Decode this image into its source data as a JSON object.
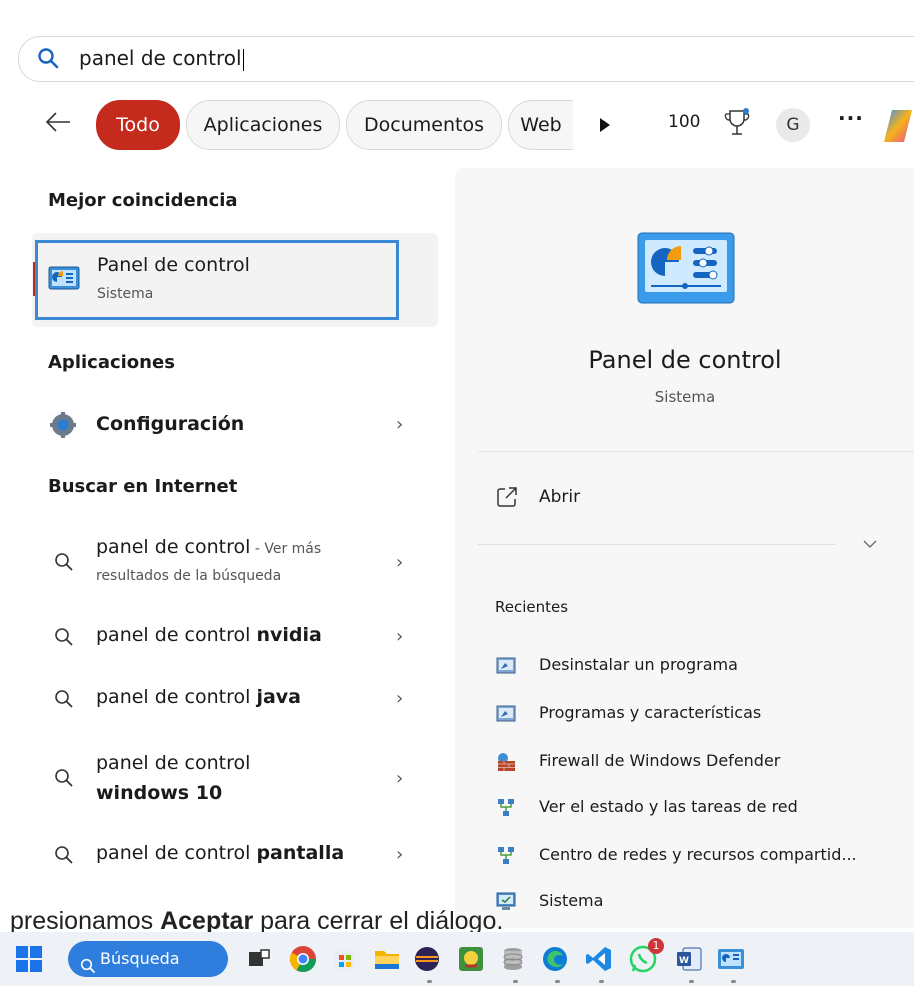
{
  "search": {
    "query": "panel de control"
  },
  "filters": {
    "tabs": [
      {
        "label": "Todo",
        "active": true
      },
      {
        "label": "Aplicaciones",
        "active": false
      },
      {
        "label": "Documentos",
        "active": false
      },
      {
        "label": "Web",
        "active": false
      }
    ],
    "points": "100",
    "avatar_initial": "G",
    "more": "···"
  },
  "best_match": {
    "section_title": "Mejor coincidencia",
    "title": "Panel de control",
    "subtitle": "Sistema"
  },
  "apps": {
    "section_title": "Aplicaciones",
    "items": [
      {
        "label": "Configuración"
      }
    ]
  },
  "internet": {
    "section_title": "Buscar en Internet",
    "items": [
      {
        "prefix": "panel de control",
        "bold": "",
        "suffix": " - Ver más",
        "line2": "resultados de la búsqueda"
      },
      {
        "prefix": "panel de control ",
        "bold": "nvidia"
      },
      {
        "prefix": "panel de control ",
        "bold": "java"
      },
      {
        "prefix": "panel de control",
        "bold": "windows 10"
      },
      {
        "prefix": "panel de control ",
        "bold": "pantalla"
      }
    ]
  },
  "detail": {
    "title": "Panel de control",
    "subtitle": "Sistema",
    "open_label": "Abrir",
    "recent_title": "Recientes",
    "recent": [
      {
        "label": "Desinstalar un programa",
        "icon": "programs-icon"
      },
      {
        "label": "Programas y características",
        "icon": "programs-icon"
      },
      {
        "label": "Firewall de Windows Defender",
        "icon": "firewall-icon"
      },
      {
        "label": "Ver el estado y las tareas de red",
        "icon": "network-icon"
      },
      {
        "label": "Centro de redes y recursos compartid...",
        "icon": "network-icon"
      },
      {
        "label": "Sistema",
        "icon": "system-icon"
      }
    ]
  },
  "document": {
    "before": "presionamos ",
    "bold": "Aceptar",
    "after": " para cerrar el diálogo."
  },
  "taskbar": {
    "search_label": "Búsqueda",
    "whatsapp_badge": "1"
  },
  "colors": {
    "accent": "#c42b1c",
    "highlight_border": "#3b88d5",
    "taskbar_search": "#2f7ddc"
  }
}
